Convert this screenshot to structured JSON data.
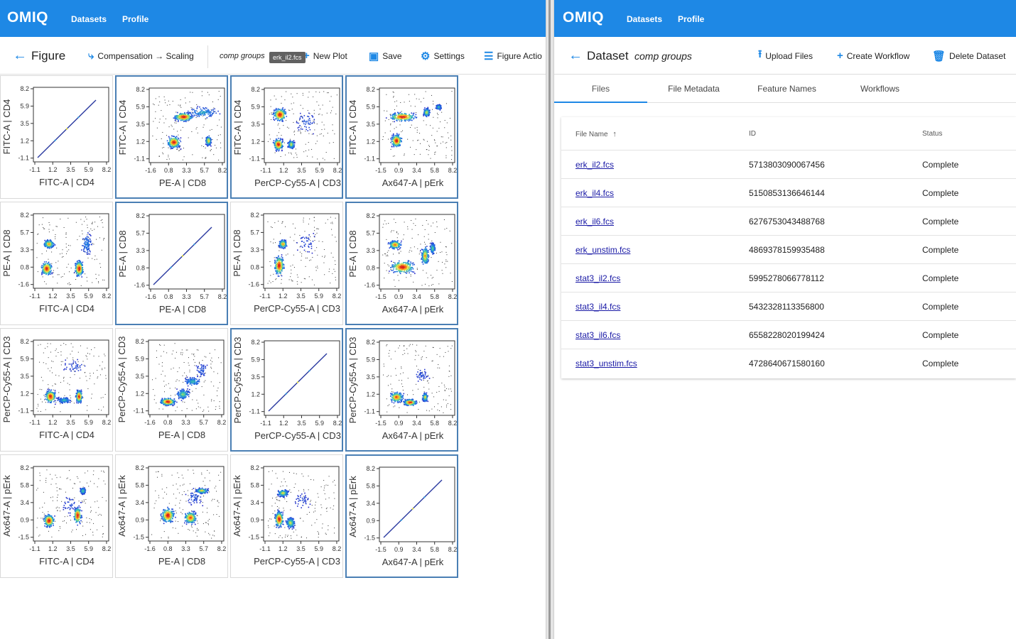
{
  "left": {
    "appbar": {
      "brand": "OMIQ",
      "nav": [
        "Datasets",
        "Profile"
      ]
    },
    "toolbar": {
      "title": "Figure",
      "compensation": "Compensation → Scaling",
      "dataset": "comp groups",
      "tooltip": "erk_il2.fcs",
      "new_plot": "New Plot",
      "save": "Save",
      "settings": "Settings",
      "figure_actions": "Figure Actio"
    },
    "channels": [
      {
        "label": "FITC-A | CD4",
        "ticks": [
          "-1.1",
          "1.2",
          "3.5",
          "5.9",
          "8.2"
        ],
        "ticks_y": [
          "8.2",
          "5.9",
          "3.5",
          "1.2",
          "-1.1"
        ]
      },
      {
        "label": "PE-A | CD8",
        "ticks": [
          "-1.6",
          "0.8",
          "3.3",
          "5.7",
          "8.2"
        ],
        "ticks_y": [
          "8.2",
          "5.7",
          "3.3",
          "0.8",
          "-1.6"
        ]
      },
      {
        "label": "PerCP-Cy55-A | CD3",
        "ticks": [
          "-1.1",
          "1.2",
          "3.5",
          "5.9",
          "8.2"
        ],
        "ticks_y": [
          "8.2",
          "5.9",
          "3.5",
          "1.2",
          "-1.1"
        ]
      },
      {
        "label": "Ax647-A | pErk",
        "ticks": [
          "-1.5",
          "0.9",
          "3.4",
          "5.8",
          "8.2"
        ],
        "ticks_y": [
          "8.2",
          "5.8",
          "3.4",
          "0.9",
          "-1.5"
        ]
      }
    ],
    "plots": [
      {
        "row": 0,
        "col": 0,
        "kind": "diag"
      },
      {
        "row": 0,
        "col": 1,
        "kind": "density",
        "clusters": [
          [
            0.45,
            0.38,
            0.18,
            0.08,
            1.0
          ],
          [
            0.32,
            0.72,
            0.12,
            0.11,
            1.0
          ],
          [
            0.78,
            0.7,
            0.05,
            0.09,
            0.8
          ],
          [
            0.7,
            0.32,
            0.3,
            0.1,
            0.45
          ]
        ]
      },
      {
        "row": 0,
        "col": 2,
        "kind": "density",
        "clusters": [
          [
            0.2,
            0.35,
            0.12,
            0.12,
            1.0
          ],
          [
            0.18,
            0.75,
            0.09,
            0.11,
            1.0
          ],
          [
            0.35,
            0.75,
            0.06,
            0.08,
            0.7
          ],
          [
            0.55,
            0.45,
            0.2,
            0.2,
            0.2
          ]
        ]
      },
      {
        "row": 0,
        "col": 3,
        "kind": "density",
        "clusters": [
          [
            0.3,
            0.38,
            0.25,
            0.08,
            1.0
          ],
          [
            0.22,
            0.7,
            0.1,
            0.12,
            1.0
          ],
          [
            0.62,
            0.32,
            0.06,
            0.08,
            0.7
          ],
          [
            0.78,
            0.25,
            0.05,
            0.05,
            0.55
          ]
        ]
      },
      {
        "row": 1,
        "col": 0,
        "kind": "density",
        "clusters": [
          [
            0.2,
            0.4,
            0.1,
            0.08,
            0.8
          ],
          [
            0.17,
            0.73,
            0.1,
            0.13,
            1.0
          ],
          [
            0.6,
            0.73,
            0.08,
            0.15,
            1.0
          ],
          [
            0.7,
            0.4,
            0.1,
            0.2,
            0.35
          ]
        ]
      },
      {
        "row": 1,
        "col": 1,
        "kind": "diag"
      },
      {
        "row": 1,
        "col": 2,
        "kind": "density",
        "clusters": [
          [
            0.2,
            0.69,
            0.09,
            0.18,
            1.0
          ],
          [
            0.25,
            0.4,
            0.08,
            0.08,
            0.8
          ],
          [
            0.55,
            0.38,
            0.2,
            0.2,
            0.15
          ]
        ]
      },
      {
        "row": 1,
        "col": 3,
        "kind": "density",
        "clusters": [
          [
            0.2,
            0.4,
            0.12,
            0.08,
            0.85
          ],
          [
            0.3,
            0.7,
            0.22,
            0.12,
            1.0
          ],
          [
            0.6,
            0.55,
            0.07,
            0.18,
            0.8
          ],
          [
            0.7,
            0.45,
            0.05,
            0.1,
            0.6
          ]
        ]
      },
      {
        "row": 2,
        "col": 0,
        "kind": "density",
        "clusters": [
          [
            0.22,
            0.75,
            0.1,
            0.12,
            1.0
          ],
          [
            0.6,
            0.75,
            0.06,
            0.12,
            1.0
          ],
          [
            0.4,
            0.8,
            0.12,
            0.06,
            0.5
          ],
          [
            0.55,
            0.35,
            0.25,
            0.15,
            0.15
          ]
        ]
      },
      {
        "row": 2,
        "col": 1,
        "kind": "density",
        "clusters": [
          [
            0.25,
            0.82,
            0.14,
            0.07,
            1.0
          ],
          [
            0.45,
            0.72,
            0.12,
            0.1,
            0.6
          ],
          [
            0.58,
            0.55,
            0.15,
            0.08,
            0.5
          ],
          [
            0.7,
            0.4,
            0.12,
            0.15,
            0.2
          ]
        ]
      },
      {
        "row": 2,
        "col": 2,
        "kind": "diag"
      },
      {
        "row": 2,
        "col": 3,
        "kind": "density",
        "clusters": [
          [
            0.22,
            0.75,
            0.13,
            0.1,
            0.9
          ],
          [
            0.4,
            0.82,
            0.12,
            0.06,
            1.0
          ],
          [
            0.6,
            0.75,
            0.05,
            0.08,
            0.75
          ],
          [
            0.55,
            0.45,
            0.15,
            0.15,
            0.15
          ]
        ]
      },
      {
        "row": 3,
        "col": 0,
        "kind": "density",
        "clusters": [
          [
            0.2,
            0.72,
            0.1,
            0.12,
            1.0
          ],
          [
            0.58,
            0.65,
            0.07,
            0.16,
            1.0
          ],
          [
            0.65,
            0.32,
            0.05,
            0.06,
            0.6
          ],
          [
            0.5,
            0.5,
            0.2,
            0.2,
            0.15
          ]
        ]
      },
      {
        "row": 3,
        "col": 1,
        "kind": "density",
        "clusters": [
          [
            0.25,
            0.65,
            0.12,
            0.14,
            1.0
          ],
          [
            0.55,
            0.68,
            0.12,
            0.12,
            0.9
          ],
          [
            0.7,
            0.32,
            0.12,
            0.05,
            0.75
          ],
          [
            0.6,
            0.4,
            0.15,
            0.15,
            0.2
          ]
        ]
      },
      {
        "row": 3,
        "col": 2,
        "kind": "density",
        "clusters": [
          [
            0.2,
            0.7,
            0.08,
            0.15,
            1.0
          ],
          [
            0.35,
            0.75,
            0.08,
            0.1,
            0.7
          ],
          [
            0.25,
            0.35,
            0.1,
            0.07,
            0.7
          ],
          [
            0.5,
            0.45,
            0.15,
            0.15,
            0.15
          ]
        ]
      },
      {
        "row": 3,
        "col": 3,
        "kind": "diag"
      }
    ]
  },
  "right": {
    "appbar": {
      "brand": "OMIQ",
      "nav": [
        "Datasets",
        "Profile"
      ]
    },
    "toolbar": {
      "title": "Dataset",
      "dataset_name": "comp groups",
      "upload": "Upload Files",
      "create_workflow": "Create Workflow",
      "delete": "Delete Dataset"
    },
    "tabs": [
      "Files",
      "File Metadata",
      "Feature Names",
      "Workflows"
    ],
    "table": {
      "headers": {
        "name": "File Name",
        "sort": "↑",
        "id": "ID",
        "status": "Status"
      },
      "rows": [
        {
          "name": "erk_il2.fcs",
          "id": "5713803090067456",
          "status": "Complete"
        },
        {
          "name": "erk_il4.fcs",
          "id": "5150853136646144",
          "status": "Complete"
        },
        {
          "name": "erk_il6.fcs",
          "id": "6276753043488768",
          "status": "Complete"
        },
        {
          "name": "erk_unstim.fcs",
          "id": "4869378159935488",
          "status": "Complete"
        },
        {
          "name": "stat3_il2.fcs",
          "id": "5995278066778112",
          "status": "Complete"
        },
        {
          "name": "stat3_il4.fcs",
          "id": "5432328113356800",
          "status": "Complete"
        },
        {
          "name": "stat3_il6.fcs",
          "id": "6558228020199424",
          "status": "Complete"
        },
        {
          "name": "stat3_unstim.fcs",
          "id": "4728640671580160",
          "status": "Complete"
        }
      ]
    }
  }
}
